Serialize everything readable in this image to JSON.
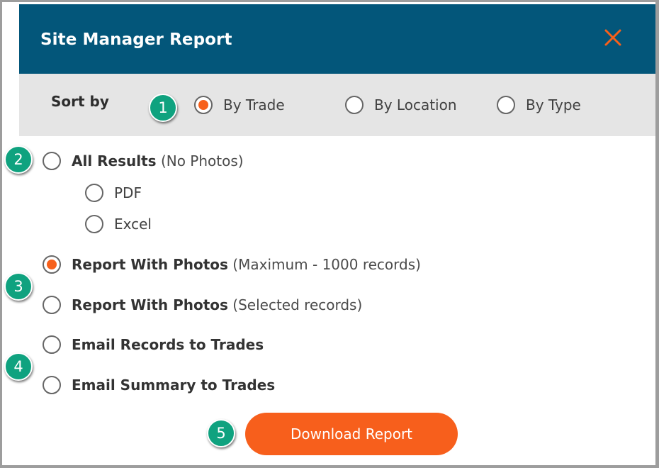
{
  "dialog": {
    "title": "Site Manager Report",
    "close_icon": "close-icon"
  },
  "sort": {
    "label": "Sort by",
    "options": [
      {
        "label": "By Trade",
        "checked": true
      },
      {
        "label": "By Location",
        "checked": false
      },
      {
        "label": "By Type",
        "checked": false
      }
    ]
  },
  "report_options": {
    "all_results": {
      "label": "All Results",
      "note": "(No Photos)",
      "checked": false
    },
    "formats": [
      {
        "label": "PDF",
        "checked": false
      },
      {
        "label": "Excel",
        "checked": false
      }
    ],
    "with_photos_max": {
      "label": "Report With Photos",
      "note": "(Maximum - 1000 records)",
      "checked": true
    },
    "with_photos_selected": {
      "label": "Report With Photos",
      "note": "(Selected records)",
      "checked": false
    },
    "email_records": {
      "label": "Email Records to Trades",
      "checked": false
    },
    "email_summary": {
      "label": "Email Summary to Trades",
      "checked": false
    }
  },
  "actions": {
    "download_label": "Download Report"
  },
  "badges": [
    "1",
    "2",
    "3",
    "4",
    "5"
  ],
  "colors": {
    "header_bg": "#03567a",
    "accent": "#f7601b",
    "badge": "#0fa27f",
    "sort_bar_bg": "#e5e5e5"
  }
}
